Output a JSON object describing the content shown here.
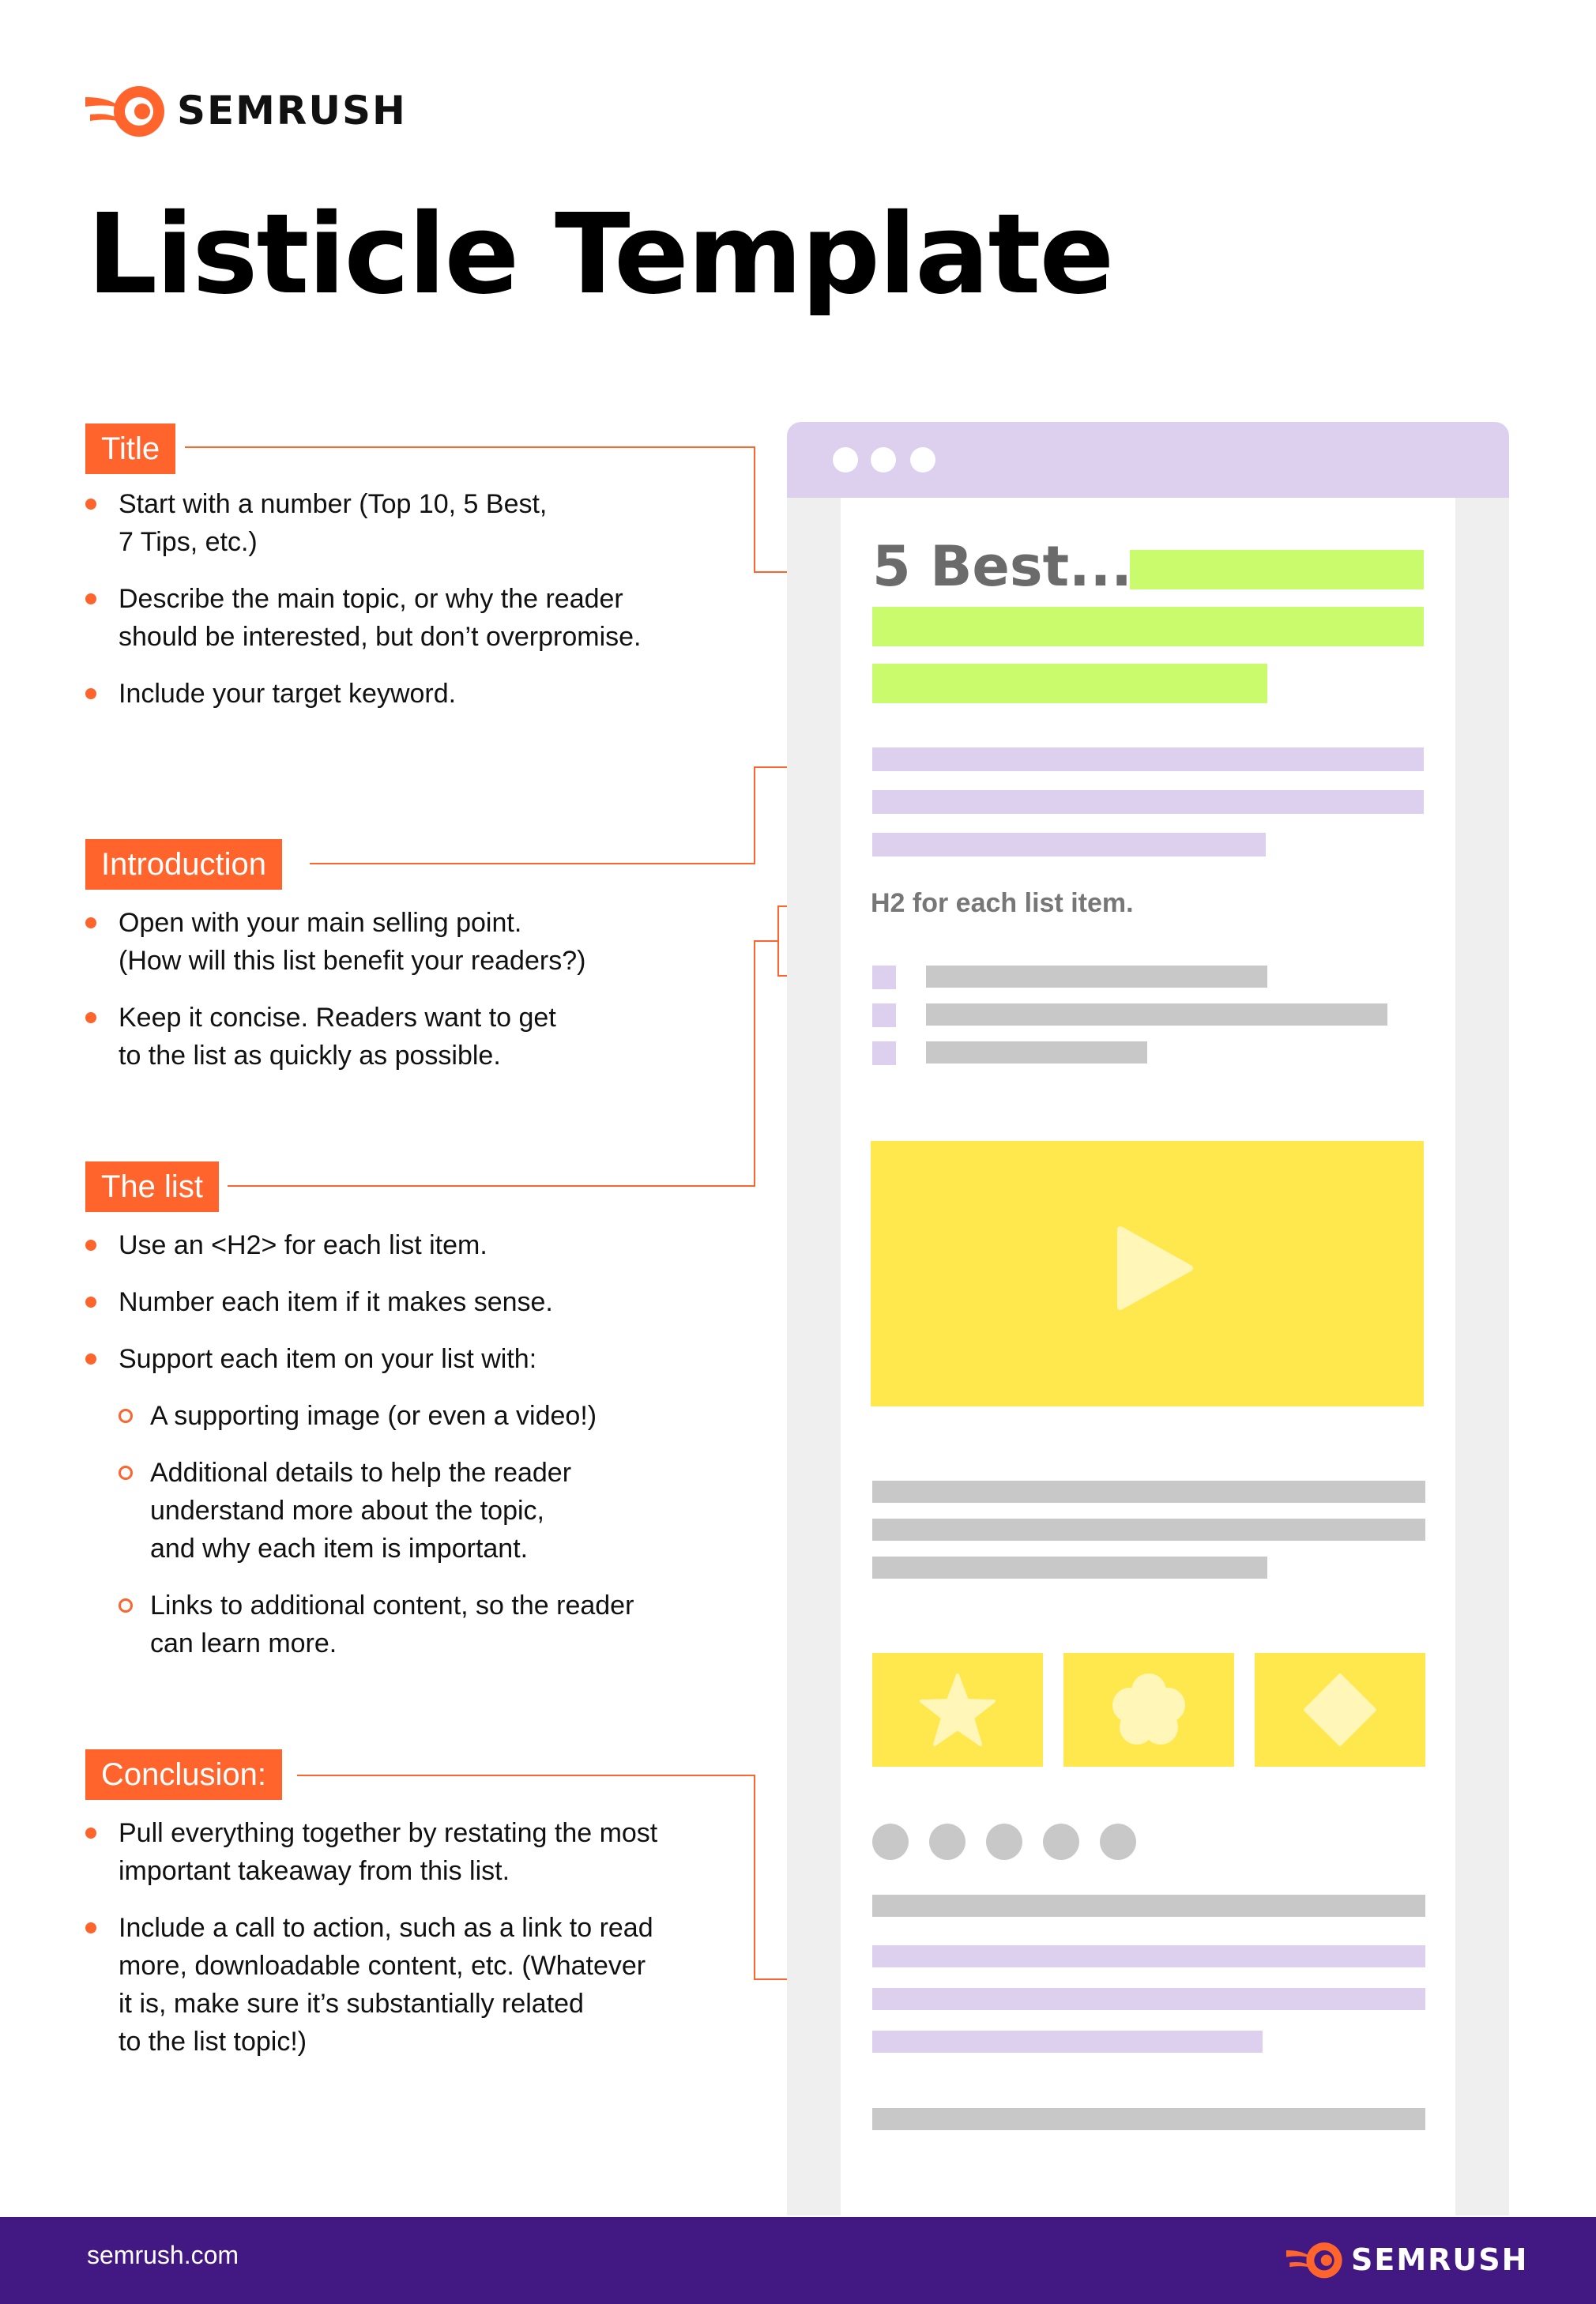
{
  "brand": {
    "name": "SEMRUSH",
    "accent": "#ff642d",
    "purple": "#421983",
    "logo_icon": "semrush-flame-icon"
  },
  "page_title": "Listicle Template",
  "sections": {
    "title": {
      "tag": "Title",
      "bullets": [
        [
          "Start with a number (Top 10, 5 Best,",
          "7 Tips, etc.)"
        ],
        [
          "Describe the main topic, or why the reader",
          "should be interested, but don’t overpromise."
        ],
        [
          "Include your target keyword."
        ]
      ]
    },
    "introduction": {
      "tag": "Introduction",
      "bullets": [
        [
          "Open with your main selling point.",
          "(How will this list benefit your readers?)"
        ],
        [
          "Keep it concise. Readers want to get",
          "to the list as quickly as possible."
        ]
      ]
    },
    "the_list": {
      "tag": "The list",
      "bullets": [
        [
          "Use an <H2> for each list item."
        ],
        [
          "Number each item if it makes sense."
        ],
        [
          "Support each item on your list with:"
        ]
      ],
      "sub_bullets": [
        [
          "A supporting image (or even a video!)"
        ],
        [
          "Additional details to help the reader",
          "understand more about the topic,",
          "and why each item is important."
        ],
        [
          "Links to additional content, so the reader",
          "can learn more."
        ]
      ]
    },
    "conclusion": {
      "tag": "Conclusion:",
      "bullets": [
        [
          "Pull everything together by restating the most",
          "important takeaway from this list."
        ],
        [
          "Include a call to action, such as a link to read",
          "more, downloadable content, etc. (Whatever",
          "it is, make sure it’s substantially related",
          "to the list topic!)"
        ]
      ]
    }
  },
  "mockup": {
    "heading": "5 Best...",
    "h2_label": "H2  for each list item.",
    "icons": [
      "play-icon",
      "star-icon",
      "flower-icon",
      "diamond-icon"
    ],
    "pagination_dots": 5,
    "colors": {
      "green": "#c9fb6d",
      "lavender": "#ddd0ee",
      "gray": "#c8c8c8",
      "yellow": "#ffe84d"
    }
  },
  "footer": {
    "url": "semrush.com",
    "logo_text": "SEMRUSH"
  }
}
